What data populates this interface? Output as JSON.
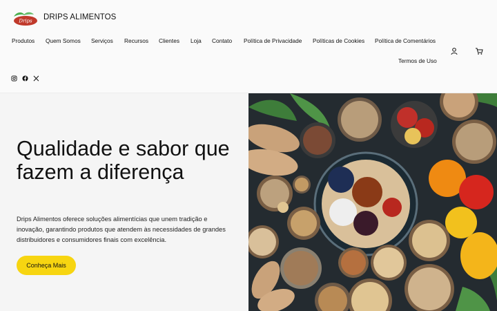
{
  "header": {
    "logo_text": "Drips",
    "brand": "DRIPS ALIMENTOS"
  },
  "nav": {
    "items": [
      {
        "label": "Produtos"
      },
      {
        "label": "Quem Somos"
      },
      {
        "label": "Serviços"
      },
      {
        "label": "Recursos"
      },
      {
        "label": "Clientes"
      },
      {
        "label": "Loja"
      },
      {
        "label": "Contato"
      },
      {
        "label": "Política de Privacidade"
      },
      {
        "label": "Políticas de Cookies"
      },
      {
        "label": "Política de Comentários"
      }
    ],
    "second_row": "Termos de Uso"
  },
  "icons": {
    "account": "user-icon",
    "cart": "cart-icon",
    "social": [
      "instagram-icon",
      "facebook-icon",
      "x-icon"
    ]
  },
  "hero": {
    "headline": "Qualidade e sabor que fazem a diferença",
    "description": "Drips Alimentos oferece soluções alimentícias que unem tradição e inovação, garantindo produtos que atendem às necessidades de grandes distribuidores e consumidores finais com excelência.",
    "cta_label": "Conheça Mais"
  },
  "colors": {
    "accent": "#f7d511",
    "logo_red": "#c0392b",
    "logo_green": "#4caf50"
  }
}
